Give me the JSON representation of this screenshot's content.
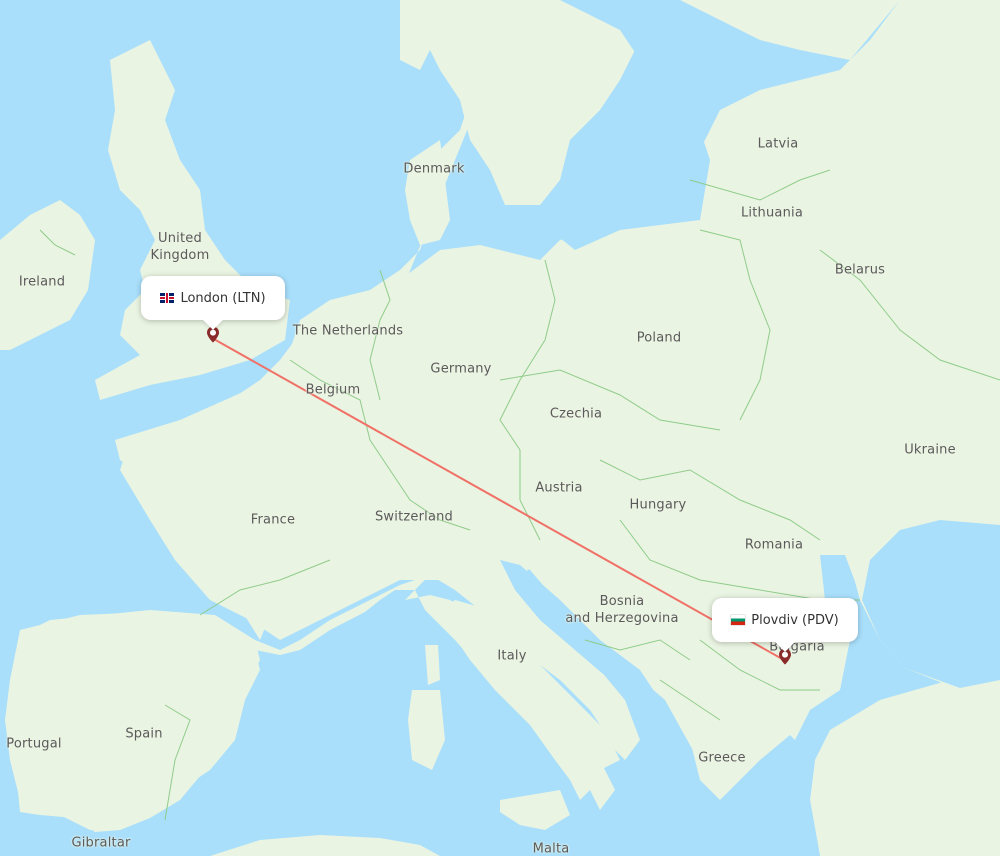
{
  "map": {
    "colors": {
      "water": "#a9dffb",
      "land": "#eaf4e2",
      "land_dark": "#dcebd2",
      "border": "#8fcc8a",
      "route": "#f07167",
      "marker": "#8b2a2a",
      "label": "#5a5a5a"
    },
    "route": {
      "origin": {
        "city": "London",
        "code": "LTN",
        "label": "London (LTN)",
        "flag": "flag-uk-icon"
      },
      "destination": {
        "city": "Plovdiv",
        "code": "PDV",
        "label": "Plovdiv (PDV)",
        "flag": "flag-bulgaria-icon"
      }
    },
    "country_labels": [
      {
        "id": "ireland",
        "text": "Ireland"
      },
      {
        "id": "united-kingdom",
        "text": "United\nKingdom"
      },
      {
        "id": "denmark",
        "text": "Denmark"
      },
      {
        "id": "latvia",
        "text": "Latvia"
      },
      {
        "id": "lithuania",
        "text": "Lithuania"
      },
      {
        "id": "belarus",
        "text": "Belarus"
      },
      {
        "id": "the-netherlands",
        "text": "The Netherlands"
      },
      {
        "id": "germany",
        "text": "Germany"
      },
      {
        "id": "poland",
        "text": "Poland"
      },
      {
        "id": "belgium",
        "text": "Belgium"
      },
      {
        "id": "czechia",
        "text": "Czechia"
      },
      {
        "id": "ukraine",
        "text": "Ukraine"
      },
      {
        "id": "austria",
        "text": "Austria"
      },
      {
        "id": "hungary",
        "text": "Hungary"
      },
      {
        "id": "france",
        "text": "France"
      },
      {
        "id": "switzerland",
        "text": "Switzerland"
      },
      {
        "id": "romania",
        "text": "Romania"
      },
      {
        "id": "bosnia",
        "text": "Bosnia\nand Herzegovina"
      },
      {
        "id": "bulgaria",
        "text": "Bulgaria"
      },
      {
        "id": "italy",
        "text": "Italy"
      },
      {
        "id": "spain",
        "text": "Spain"
      },
      {
        "id": "portugal",
        "text": "Portugal"
      },
      {
        "id": "greece",
        "text": "Greece"
      },
      {
        "id": "gibraltar",
        "text": "Gibraltar"
      },
      {
        "id": "malta",
        "text": "Malta"
      }
    ]
  }
}
